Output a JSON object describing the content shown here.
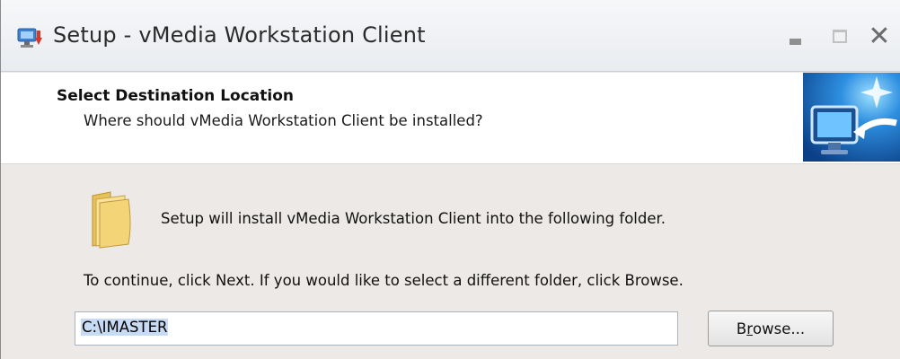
{
  "window": {
    "title": "Setup - vMedia Workstation Client",
    "controls": {
      "minimize": "minimize",
      "maximize": "maximize",
      "close": "close"
    }
  },
  "header": {
    "title": "Select Destination Location",
    "subtitle": "Where should vMedia Workstation Client be installed?"
  },
  "body": {
    "info": "Setup will install vMedia Workstation Client into the following folder.",
    "continue_text": "To continue, click Next. If you would like to select a different folder, click Browse.",
    "path_value": "C:\\IMASTER",
    "browse_label_prefix": "B",
    "browse_label_mnemonic": "r",
    "browse_label_suffix": "owse..."
  },
  "icons": {
    "title": "installer-icon",
    "header": "computer-arrow-icon",
    "folder": "folder-icon"
  },
  "colors": {
    "selection": "#c8dbf5",
    "header_image": "#1b6fc0"
  }
}
